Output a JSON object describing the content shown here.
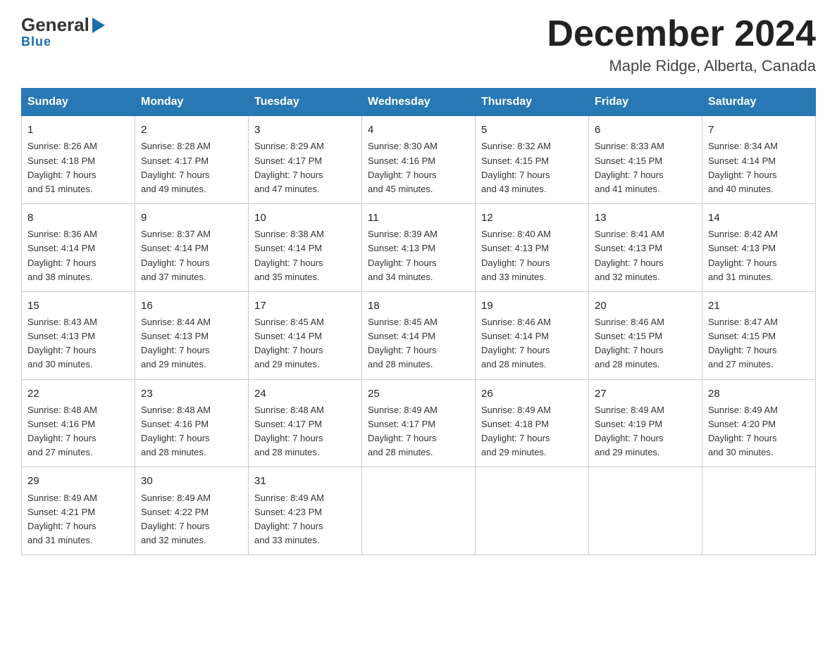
{
  "logo": {
    "general": "General",
    "blue": "Blue"
  },
  "title": {
    "month_year": "December 2024",
    "location": "Maple Ridge, Alberta, Canada"
  },
  "days_of_week": [
    "Sunday",
    "Monday",
    "Tuesday",
    "Wednesday",
    "Thursday",
    "Friday",
    "Saturday"
  ],
  "weeks": [
    [
      {
        "day": "1",
        "sunrise": "8:26 AM",
        "sunset": "4:18 PM",
        "daylight": "7 hours and 51 minutes."
      },
      {
        "day": "2",
        "sunrise": "8:28 AM",
        "sunset": "4:17 PM",
        "daylight": "7 hours and 49 minutes."
      },
      {
        "day": "3",
        "sunrise": "8:29 AM",
        "sunset": "4:17 PM",
        "daylight": "7 hours and 47 minutes."
      },
      {
        "day": "4",
        "sunrise": "8:30 AM",
        "sunset": "4:16 PM",
        "daylight": "7 hours and 45 minutes."
      },
      {
        "day": "5",
        "sunrise": "8:32 AM",
        "sunset": "4:15 PM",
        "daylight": "7 hours and 43 minutes."
      },
      {
        "day": "6",
        "sunrise": "8:33 AM",
        "sunset": "4:15 PM",
        "daylight": "7 hours and 41 minutes."
      },
      {
        "day": "7",
        "sunrise": "8:34 AM",
        "sunset": "4:14 PM",
        "daylight": "7 hours and 40 minutes."
      }
    ],
    [
      {
        "day": "8",
        "sunrise": "8:36 AM",
        "sunset": "4:14 PM",
        "daylight": "7 hours and 38 minutes."
      },
      {
        "day": "9",
        "sunrise": "8:37 AM",
        "sunset": "4:14 PM",
        "daylight": "7 hours and 37 minutes."
      },
      {
        "day": "10",
        "sunrise": "8:38 AM",
        "sunset": "4:14 PM",
        "daylight": "7 hours and 35 minutes."
      },
      {
        "day": "11",
        "sunrise": "8:39 AM",
        "sunset": "4:13 PM",
        "daylight": "7 hours and 34 minutes."
      },
      {
        "day": "12",
        "sunrise": "8:40 AM",
        "sunset": "4:13 PM",
        "daylight": "7 hours and 33 minutes."
      },
      {
        "day": "13",
        "sunrise": "8:41 AM",
        "sunset": "4:13 PM",
        "daylight": "7 hours and 32 minutes."
      },
      {
        "day": "14",
        "sunrise": "8:42 AM",
        "sunset": "4:13 PM",
        "daylight": "7 hours and 31 minutes."
      }
    ],
    [
      {
        "day": "15",
        "sunrise": "8:43 AM",
        "sunset": "4:13 PM",
        "daylight": "7 hours and 30 minutes."
      },
      {
        "day": "16",
        "sunrise": "8:44 AM",
        "sunset": "4:13 PM",
        "daylight": "7 hours and 29 minutes."
      },
      {
        "day": "17",
        "sunrise": "8:45 AM",
        "sunset": "4:14 PM",
        "daylight": "7 hours and 29 minutes."
      },
      {
        "day": "18",
        "sunrise": "8:45 AM",
        "sunset": "4:14 PM",
        "daylight": "7 hours and 28 minutes."
      },
      {
        "day": "19",
        "sunrise": "8:46 AM",
        "sunset": "4:14 PM",
        "daylight": "7 hours and 28 minutes."
      },
      {
        "day": "20",
        "sunrise": "8:46 AM",
        "sunset": "4:15 PM",
        "daylight": "7 hours and 28 minutes."
      },
      {
        "day": "21",
        "sunrise": "8:47 AM",
        "sunset": "4:15 PM",
        "daylight": "7 hours and 27 minutes."
      }
    ],
    [
      {
        "day": "22",
        "sunrise": "8:48 AM",
        "sunset": "4:16 PM",
        "daylight": "7 hours and 27 minutes."
      },
      {
        "day": "23",
        "sunrise": "8:48 AM",
        "sunset": "4:16 PM",
        "daylight": "7 hours and 28 minutes."
      },
      {
        "day": "24",
        "sunrise": "8:48 AM",
        "sunset": "4:17 PM",
        "daylight": "7 hours and 28 minutes."
      },
      {
        "day": "25",
        "sunrise": "8:49 AM",
        "sunset": "4:17 PM",
        "daylight": "7 hours and 28 minutes."
      },
      {
        "day": "26",
        "sunrise": "8:49 AM",
        "sunset": "4:18 PM",
        "daylight": "7 hours and 29 minutes."
      },
      {
        "day": "27",
        "sunrise": "8:49 AM",
        "sunset": "4:19 PM",
        "daylight": "7 hours and 29 minutes."
      },
      {
        "day": "28",
        "sunrise": "8:49 AM",
        "sunset": "4:20 PM",
        "daylight": "7 hours and 30 minutes."
      }
    ],
    [
      {
        "day": "29",
        "sunrise": "8:49 AM",
        "sunset": "4:21 PM",
        "daylight": "7 hours and 31 minutes."
      },
      {
        "day": "30",
        "sunrise": "8:49 AM",
        "sunset": "4:22 PM",
        "daylight": "7 hours and 32 minutes."
      },
      {
        "day": "31",
        "sunrise": "8:49 AM",
        "sunset": "4:23 PM",
        "daylight": "7 hours and 33 minutes."
      },
      null,
      null,
      null,
      null
    ]
  ],
  "labels": {
    "sunrise": "Sunrise:",
    "sunset": "Sunset:",
    "daylight": "Daylight:"
  }
}
